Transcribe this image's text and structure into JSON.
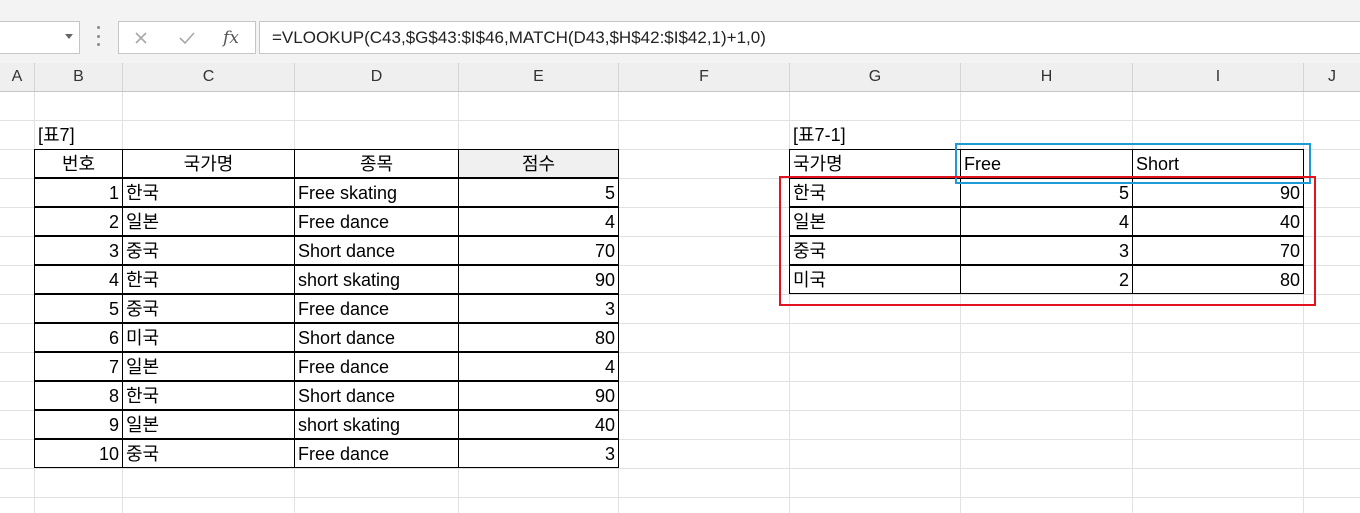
{
  "formula_bar": {
    "name_box": "",
    "cancel_icon": "x-icon",
    "enter_icon": "check-icon",
    "function_label": "fx",
    "formula": "=VLOOKUP(C43,$G$43:$I$46,MATCH(D43,$H$42:$I$42,1)+1,0)"
  },
  "columns": [
    "A",
    "B",
    "C",
    "D",
    "E",
    "F",
    "G",
    "H",
    "I",
    "J"
  ],
  "table7": {
    "title": "[표7]",
    "headers": [
      "번호",
      "국가명",
      "종목",
      "점수"
    ],
    "rows": [
      {
        "num": "1",
        "country": "한국",
        "event": "Free skating",
        "score": "5"
      },
      {
        "num": "2",
        "country": "일본",
        "event": "Free dance",
        "score": "4"
      },
      {
        "num": "3",
        "country": "중국",
        "event": "Short dance",
        "score": "70"
      },
      {
        "num": "4",
        "country": "한국",
        "event": "short skating",
        "score": "90"
      },
      {
        "num": "5",
        "country": "중국",
        "event": "Free dance",
        "score": "3"
      },
      {
        "num": "6",
        "country": "미국",
        "event": "Short dance",
        "score": "80"
      },
      {
        "num": "7",
        "country": "일본",
        "event": "Free dance",
        "score": "4"
      },
      {
        "num": "8",
        "country": "한국",
        "event": "Short dance",
        "score": "90"
      },
      {
        "num": "9",
        "country": "일본",
        "event": "short skating",
        "score": "40"
      },
      {
        "num": "10",
        "country": "중국",
        "event": "Free dance",
        "score": "3"
      }
    ]
  },
  "table71": {
    "title": "[표7-1]",
    "headers": [
      "국가명",
      "Free",
      "Short"
    ],
    "rows": [
      {
        "country": "한국",
        "free": "5",
        "short": "90"
      },
      {
        "country": "일본",
        "free": "4",
        "short": "40"
      },
      {
        "country": "중국",
        "free": "3",
        "short": "70"
      },
      {
        "country": "미국",
        "free": "2",
        "short": "80"
      }
    ]
  },
  "colors": {
    "header_highlight": "#1e9ad6",
    "lookup_range_highlight": "#e0141e",
    "score_header_fill": "#f0f0f0"
  }
}
